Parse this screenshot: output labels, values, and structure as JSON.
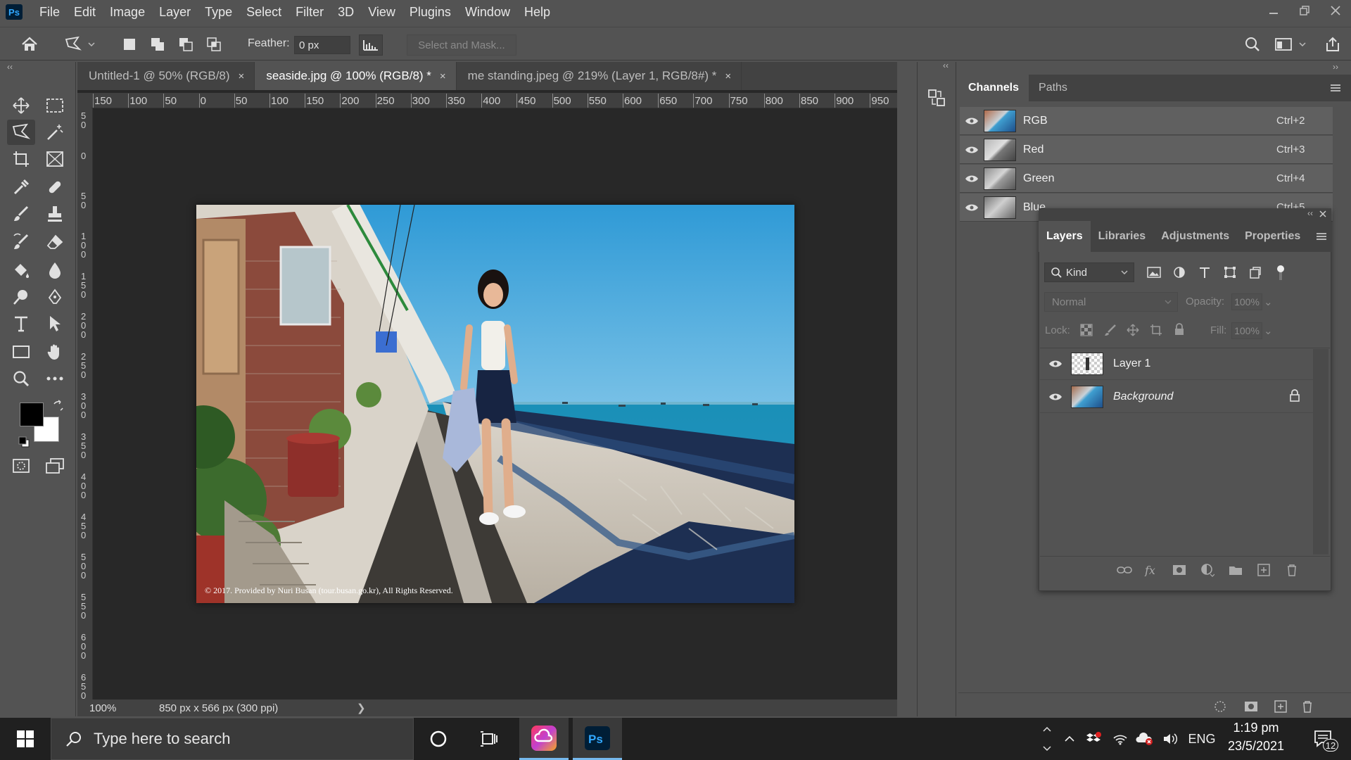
{
  "app": {
    "logo": "Ps",
    "menu": [
      "File",
      "Edit",
      "Image",
      "Layer",
      "Type",
      "Select",
      "Filter",
      "3D",
      "View",
      "Plugins",
      "Window",
      "Help"
    ],
    "window_controls": [
      "minimize-icon",
      "restore-icon",
      "close-icon"
    ]
  },
  "options_bar": {
    "feather_label": "Feather:",
    "feather_value": "0 px",
    "select_and_mask": "Select and Mask..."
  },
  "document_tabs": [
    {
      "label": "Untitled-1 @ 50% (RGB/8)",
      "active": false
    },
    {
      "label": "seaside.jpg @ 100% (RGB/8) *",
      "active": true
    },
    {
      "label": "me standing.jpeg @ 219% (Layer 1, RGB/8#) *",
      "active": false
    }
  ],
  "close_glyph": "×",
  "rulers": {
    "horizontal": [
      "150",
      "100",
      "50",
      "0",
      "50",
      "100",
      "150",
      "200",
      "250",
      "300",
      "350",
      "400",
      "450",
      "500",
      "550",
      "600",
      "650",
      "700",
      "750",
      "800",
      "850",
      "900",
      "950"
    ],
    "vertical": [
      "5\n0",
      "0",
      "5\n0",
      "1\n0\n0",
      "1\n5\n0",
      "2\n0\n0",
      "2\n5\n0",
      "3\n0\n0",
      "3\n5\n0",
      "4\n0\n0",
      "4\n5\n0",
      "5\n0\n0",
      "5\n5\n0",
      "6\n0\n0",
      "6\n5\n0"
    ]
  },
  "status_bar": {
    "zoom": "100%",
    "doc_info": "850 px x 566 px (300 ppi)",
    "arrow": "❯"
  },
  "photo": {
    "credit": "© 2017. Provided by Nuri Busan (tour.busan.go.kr), All Rights Reserved."
  },
  "channels_panel": {
    "tabs": [
      "Channels",
      "Paths"
    ],
    "channels": [
      {
        "name": "RGB",
        "shortcut": "Ctrl+2"
      },
      {
        "name": "Red",
        "shortcut": "Ctrl+3"
      },
      {
        "name": "Green",
        "shortcut": "Ctrl+4"
      },
      {
        "name": "Blue",
        "shortcut": "Ctrl+5"
      }
    ]
  },
  "layers_panel": {
    "tabs": [
      "Layers",
      "Libraries",
      "Adjustments",
      "Properties"
    ],
    "kind": "Kind",
    "blend_mode": "Normal",
    "opacity_label": "Opacity:",
    "opacity_value": "100%",
    "lock_label": "Lock:",
    "fill_label": "Fill:",
    "fill_value": "100%",
    "layers": [
      {
        "name": "Layer 1",
        "locked": false
      },
      {
        "name": "Background",
        "locked": true
      }
    ]
  },
  "taskbar": {
    "search_placeholder": "Type here to search",
    "time": "1:19 pm",
    "date": "23/5/2021",
    "language": "ENG",
    "notification_count": "12"
  },
  "colors": {
    "panel_bg": "#535353",
    "canvas_bg": "#282828",
    "ps_blue": "#31a8ff",
    "taskbar_bg": "#202020"
  }
}
